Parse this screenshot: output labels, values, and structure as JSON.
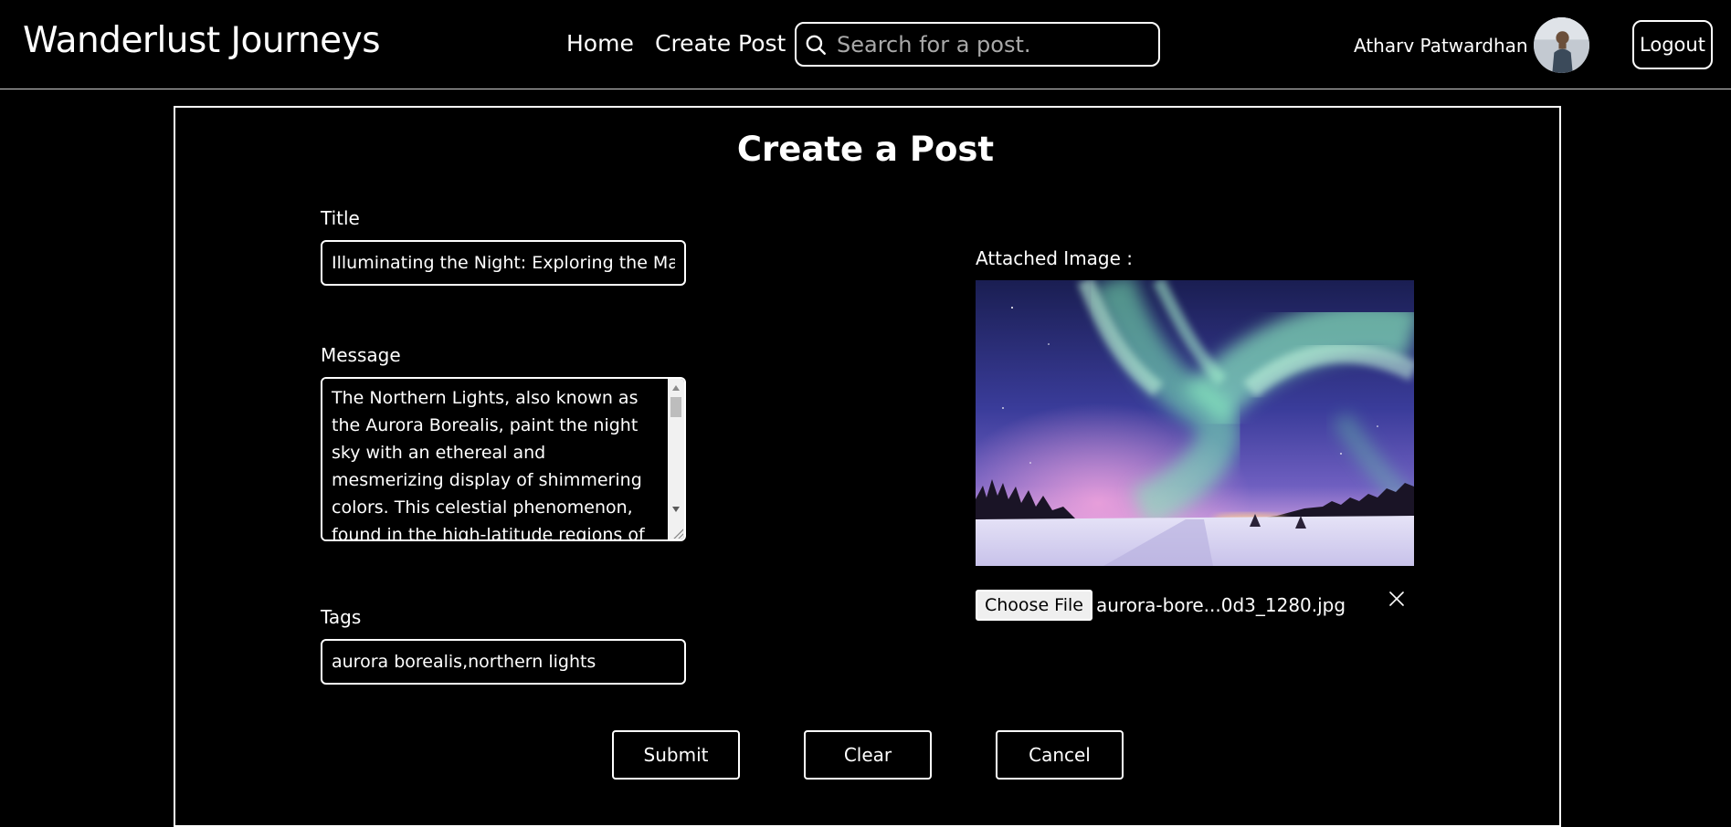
{
  "navbar": {
    "brand": "Wanderlust Journeys",
    "links": [
      {
        "label": "Home"
      },
      {
        "label": "Create Post"
      }
    ],
    "search_placeholder": "Search for a post.",
    "username": "Atharv Patwardhan",
    "logout_label": "Logout"
  },
  "form": {
    "heading": "Create a Post",
    "title_label": "Title",
    "title_value": "Illuminating the Night: Exploring the Magic",
    "message_label": "Message",
    "message_value": "The Northern Lights, also known as the Aurora Borealis, paint the night sky with an ethereal and mesmerizing display of shimmering colors. This celestial phenomenon, found in the high-latitude regions of the Earth, casts an",
    "tags_label": "Tags",
    "tags_value": "aurora borealis,northern lights",
    "attached_label": "Attached Image :",
    "choose_file_label": "Choose File",
    "file_name": "aurora-bore...0d3_1280.jpg",
    "buttons": {
      "submit": "Submit",
      "clear": "Clear",
      "cancel": "Cancel"
    }
  },
  "colors": {
    "background": "#000000",
    "foreground": "#ffffff",
    "aurora_green": "#7ef0b4",
    "sky_blue": "#3b3f9e"
  }
}
